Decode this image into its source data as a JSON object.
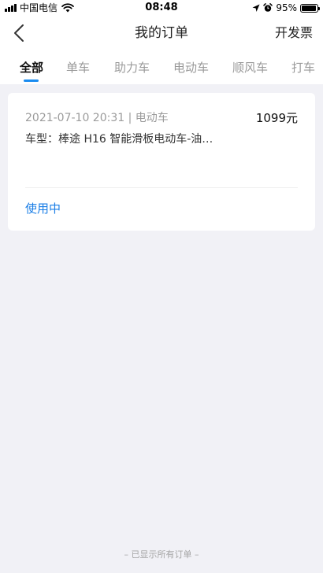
{
  "status_bar": {
    "carrier": "中国电信",
    "time": "08:48",
    "battery_percent": "95%",
    "battery_level": 0.95
  },
  "nav": {
    "title": "我的订单",
    "invoice_label": "开发票"
  },
  "tabs": [
    {
      "label": "全部",
      "active": true
    },
    {
      "label": "单车",
      "active": false
    },
    {
      "label": "助力车",
      "active": false
    },
    {
      "label": "电动车",
      "active": false
    },
    {
      "label": "顺风车",
      "active": false
    },
    {
      "label": "打车",
      "active": false
    }
  ],
  "order": {
    "meta": "2021-07-10 20:31 | 电动车",
    "price": "1099元",
    "model": "车型：棒途 H16 智能滑板电动车-油…",
    "status": "使用中",
    "status_color": "#1a7ee6"
  },
  "footer": {
    "note": "– 已显示所有订单 –"
  },
  "colors": {
    "accent": "#1a8cf0",
    "background": "#f1f1f6"
  }
}
